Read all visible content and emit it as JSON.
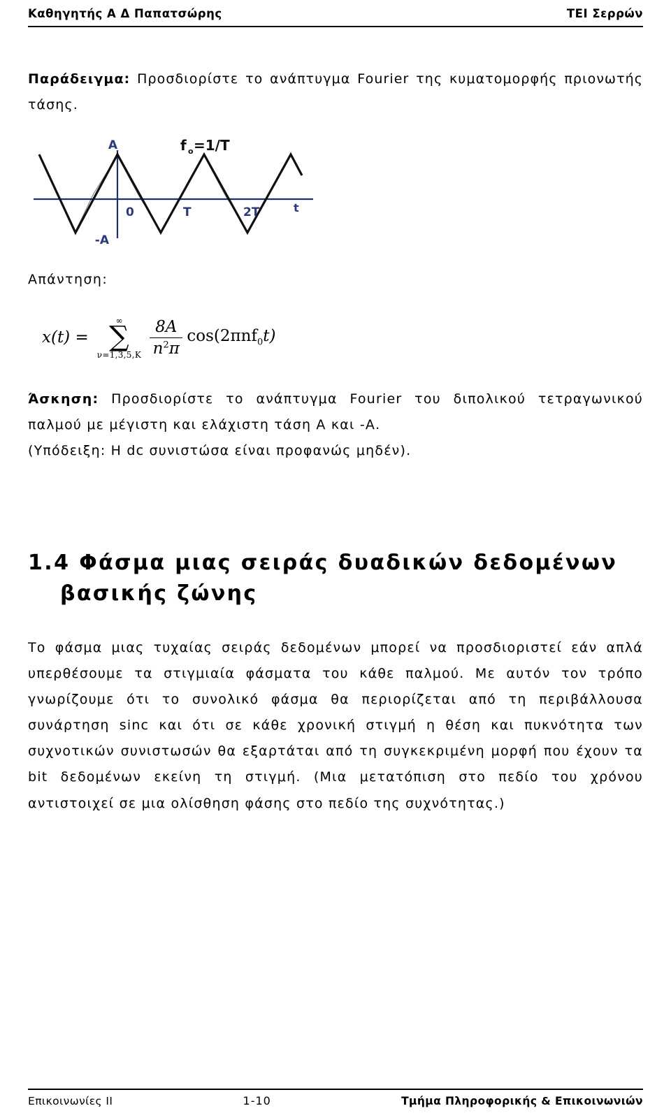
{
  "header": {
    "left": "Καθηγητής Α Δ Παπατσώρης",
    "right": "ΤΕΙ Σερρών"
  },
  "example": {
    "label": "Παράδειγμα:",
    "text": " Προσδιορίστε το ανάπτυγμα Fourier της κυματομορφής πριονωτής τάσης."
  },
  "figure": {
    "label_f": "f",
    "label_f_sub": "o",
    "label_f_rest": "=1/T",
    "label_A": "A",
    "label_minusA": "-A",
    "label_zero": "0",
    "label_T": "T",
    "label_2T": "2T",
    "label_t": "t"
  },
  "answer": {
    "label": "Απάντηση:",
    "formula": {
      "lhs": "x(t) =",
      "sum_top": "∞",
      "sum_bottom": "ν=1,3,5,Κ",
      "numerator": "8A",
      "denominator_n": "n",
      "denominator_exp": "2",
      "denominator_pi": "π",
      "cos_part": "cos(2πnf",
      "cos_sub": "0",
      "cos_tail": "t)"
    }
  },
  "exercise": {
    "label": "Άσκηση:",
    "text": " Προσδιορίστε το ανάπτυγμα Fourier του διπολικού τετραγωνικού παλμού με μέγιστη και ελάχιστη τάση  Α και  -Α.",
    "hint": "(Υπόδειξη: Η dc συνιστώσα είναι προφανώς μηδέν)."
  },
  "section": {
    "number": "1.4",
    "title_line1": "Φάσμα μιας σειράς δυαδικών δεδομένων",
    "title_line2": "βασικής ζώνης",
    "body": "Το φάσμα μιας τυχαίας σειράς δεδομένων μπορεί να προσδιοριστεί εάν απλά υπερθέσουμε τα στιγμιαία φάσματα του κάθε παλμού. Με αυτόν τον τρόπο γνωρίζουμε ότι το συνολικό φάσμα θα περιορίζεται από τη περιβάλλουσα συνάρτηση sinc και ότι σε κάθε χρονική στιγμή η θέση και πυκνότητα των συχνοτικών συνιστωσών θα εξαρτάται από τη συγκεκριμένη μορφή που έχουν τα bit δεδομένων εκείνη τη στιγμή. (Μια μετατόπιση στο πεδίο του χρόνου αντιστοιχεί σε μια ολίσθηση φάσης στο πεδίο της συχνότητας.)"
  },
  "footer": {
    "left": "Επικοινωνίες ΙΙ",
    "center": "1-10",
    "right": "Τμήμα Πληροφορικής & Επικοινωνιών"
  },
  "colors": {
    "text": "#000000",
    "background": "#ffffff",
    "figure_axis": "#1f2f6e",
    "figure_curve": "#111111",
    "figure_label": "#2a3a7a"
  }
}
